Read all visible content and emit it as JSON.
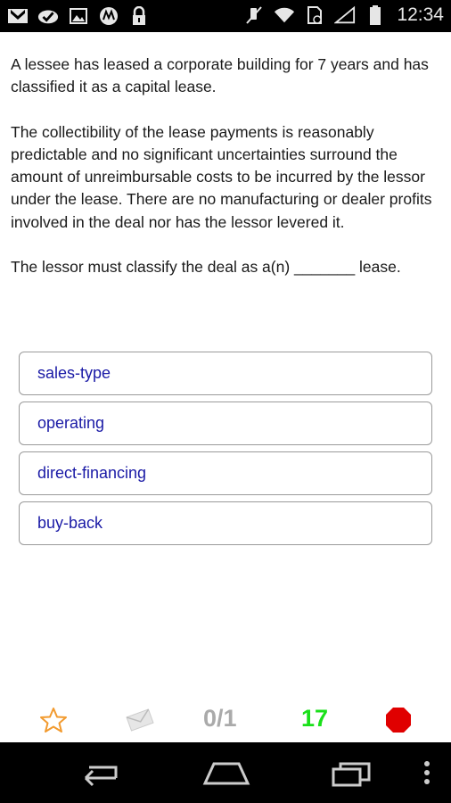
{
  "status_bar": {
    "time": "12:34",
    "left_icons": [
      "gmail-icon",
      "check-cloud-icon",
      "image-icon",
      "motorola-icon",
      "lock-icon"
    ],
    "right_icons": [
      "mute-icon",
      "wifi-icon",
      "sim-icon",
      "signal-icon",
      "battery-icon"
    ]
  },
  "question": {
    "paragraphs": [
      "A lessee has leased a corporate building for 7 years and has classified it as a capital lease.",
      "The collectibility of the lease payments is reasonably predictable and no significant uncertainties surround the amount of unreimbursable costs to be incurred by the lessor under the lease. There are no manufacturing or dealer profits involved in the deal nor has the lessor levered it.",
      "The lessor must classify the deal as a(n) _______ lease."
    ]
  },
  "answers": [
    {
      "label": "sales-type"
    },
    {
      "label": "operating"
    },
    {
      "label": "direct-financing"
    },
    {
      "label": "buy-back"
    }
  ],
  "toolbar": {
    "progress": "0/1",
    "count": "17",
    "colors": {
      "star": "#f29a2e",
      "progress": "#aaaaaa",
      "count": "#19e019",
      "stop": "#e00000"
    }
  }
}
